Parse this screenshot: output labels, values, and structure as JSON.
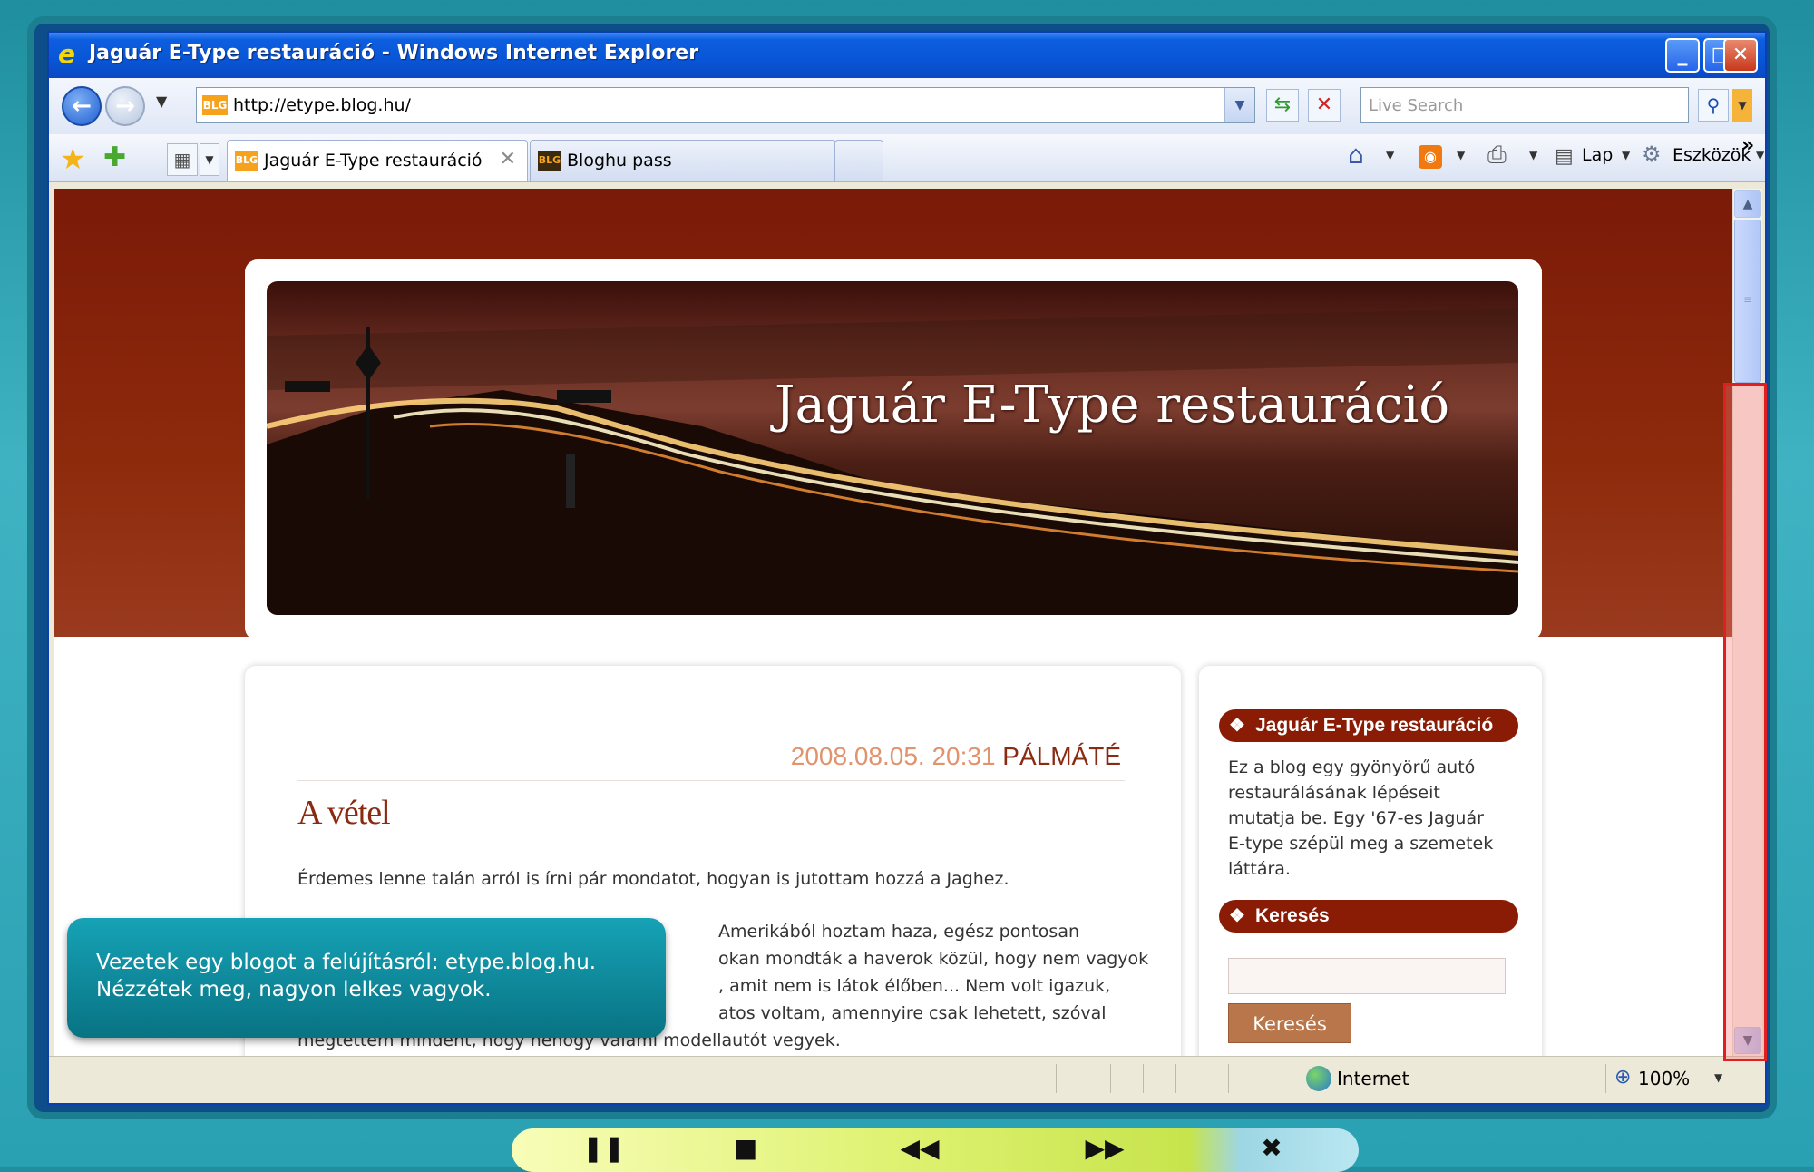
{
  "window": {
    "title": "Jaguár E-Type restauráció - Windows Internet Explorer",
    "minimize": "_",
    "maximize": "□",
    "close": "✕"
  },
  "navigation": {
    "address": "http://etype.blog.hu/",
    "search_placeholder": "Live Search"
  },
  "tabs": [
    {
      "label": "Jaguár E-Type restauráció",
      "favicon": "BLOG",
      "active": true
    },
    {
      "label": "Bloghu pass",
      "favicon": "BLOG",
      "active": false
    }
  ],
  "command_bar": {
    "page_label": "Lap",
    "tools_label": "Eszközök",
    "overflow": "»"
  },
  "blog": {
    "title": "Jaguár E-Type restauráció",
    "post": {
      "date": "2008.08.05. 20:31",
      "author": "PÁLMÁTÉ",
      "title": "A vétel",
      "lines": [
        "Érdemes lenne talán arról is írni pár mondatot, hogyan is jutottam hozzá a Jaghez.",
        "Amerikából hoztam haza, egész pontosan",
        "okan mondták a haverok közül, hogy nem vagyok",
        ", amit nem is látok élőben... Nem volt igazuk,",
        "atos voltam, amennyire csak lehetett, szóval",
        "megtettem mindent, hogy nehogy valami modellautót vegyek."
      ]
    },
    "sidebar": {
      "about_heading": "Jaguár E-Type restauráció",
      "about_lines": [
        "Ez a blog egy gyönyörű autó",
        "restaurálásának lépéseit",
        "mutatja be. Egy '67-es Jaguár",
        "E-type szépül meg a szemetek",
        "láttára."
      ],
      "search_heading": "Keresés",
      "search_button": "Keresés"
    }
  },
  "status": {
    "zone": "Internet",
    "zoom": "100%"
  },
  "caption": {
    "lines": [
      "Vezetek egy blogot a felújításról: etype.blog.hu.",
      "Nézzétek meg, nagyon lelkes vagyok."
    ]
  },
  "player": {
    "pause": "❚❚",
    "stop": "■",
    "rewind": "◀◀",
    "forward": "▶▶",
    "close": "✖"
  },
  "colors": {
    "header_bg": "#8e2a0c",
    "accent": "#8a1c06",
    "caption_bg": "#0e8a9c"
  }
}
